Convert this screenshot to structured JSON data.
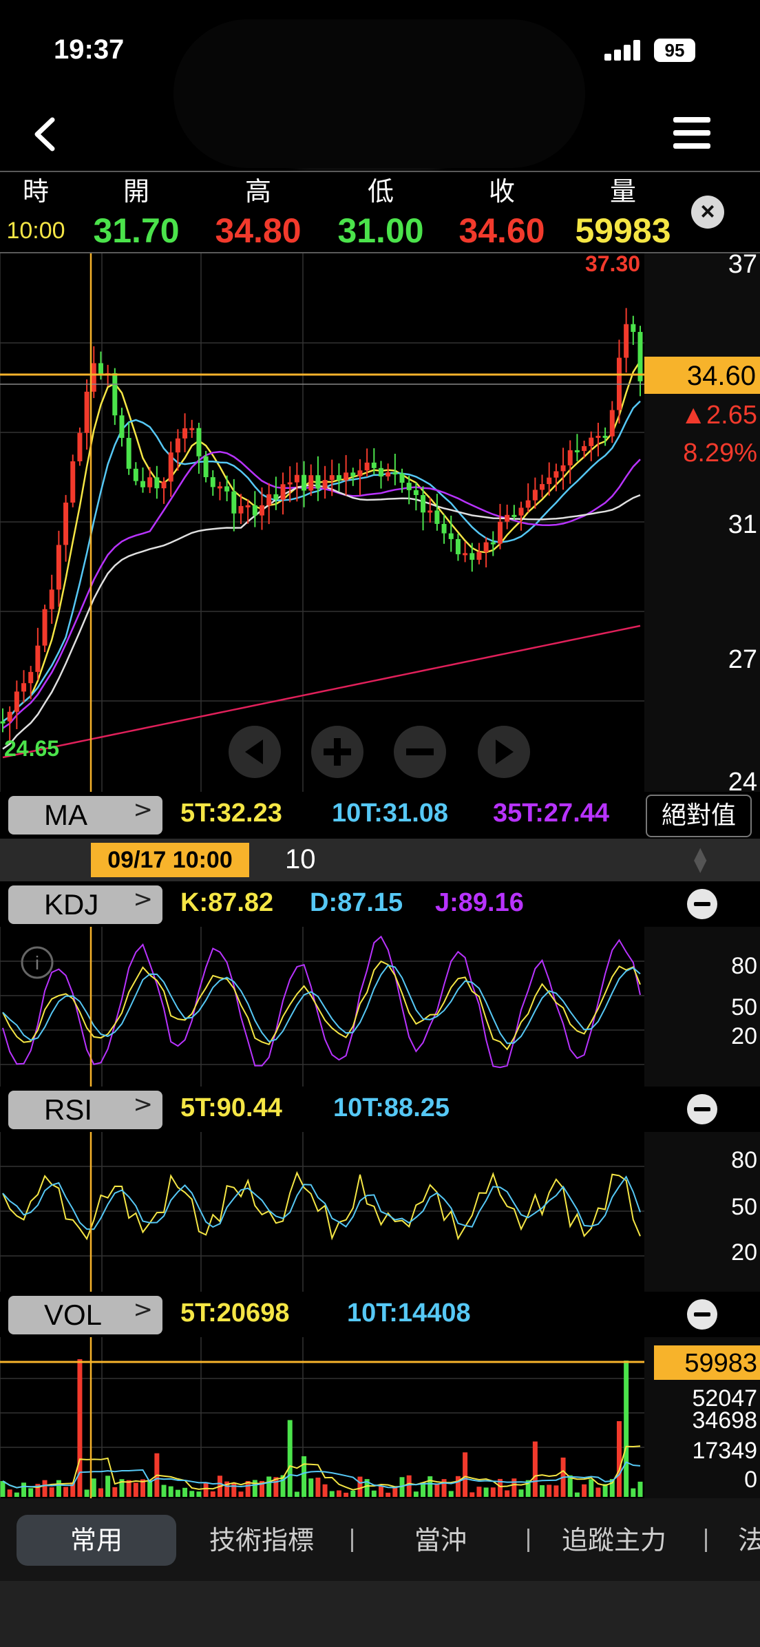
{
  "status_bar": {
    "time": "19:37",
    "battery": "95"
  },
  "quote": {
    "headers": [
      "時",
      "開",
      "高",
      "低",
      "收",
      "量"
    ],
    "values": [
      "10:00",
      "31.70",
      "34.80",
      "31.00",
      "34.60",
      "59983"
    ],
    "close_label": "×"
  },
  "main_chart": {
    "price_axis": [
      "37",
      "31",
      "27",
      "24"
    ],
    "high_label": "37.30",
    "low_label": "24.65",
    "current_price": "34.60",
    "change": "▲2.65",
    "change_pct": "8.29%"
  },
  "ma_panel": {
    "button": "MA",
    "indicators": [
      {
        "text": "5T:32.23",
        "color": "#f5e645"
      },
      {
        "text": "10T:31.08",
        "color": "#56c8f5"
      },
      {
        "text": "35T:27.44",
        "color": "#b833ff"
      }
    ],
    "abs_button": "絕對值"
  },
  "date_bar": {
    "datetime": "09/17 10:00",
    "value": "10"
  },
  "kdj_panel": {
    "button": "KDJ",
    "indicators": [
      {
        "text": "K:87.82",
        "color": "#f5e645"
      },
      {
        "text": "D:87.15",
        "color": "#56c8f5"
      },
      {
        "text": "J:89.16",
        "color": "#b833ff"
      }
    ],
    "axis": [
      "80",
      "50",
      "20"
    ]
  },
  "rsi_panel": {
    "button": "RSI",
    "indicators": [
      {
        "text": "5T:90.44",
        "color": "#f5e645"
      },
      {
        "text": "10T:88.25",
        "color": "#56c8f5"
      }
    ],
    "axis": [
      "80",
      "50",
      "20"
    ]
  },
  "vol_panel": {
    "button": "VOL",
    "indicators": [
      {
        "text": "5T:20698",
        "color": "#f5e645"
      },
      {
        "text": "10T:14408",
        "color": "#56c8f5"
      }
    ],
    "current": "59983",
    "axis": [
      "52047",
      "34698",
      "17349",
      "0"
    ]
  },
  "bottom_nav": {
    "active": "常用",
    "tabs": [
      "技術指標",
      "當沖",
      "追蹤主力",
      "法"
    ]
  },
  "colors": {
    "up": "#f23a2c",
    "down": "#4be34b",
    "accent": "#f7b32b",
    "ma5": "#f5e645",
    "ma10": "#56c8f5",
    "ma35": "#b833ff",
    "ma60": "#e0e0e0",
    "ma240": "#e0205a"
  }
}
